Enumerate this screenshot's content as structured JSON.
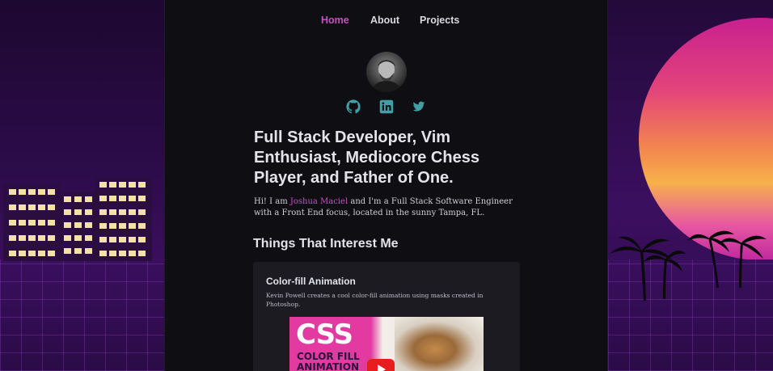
{
  "nav": {
    "items": [
      {
        "label": "Home",
        "active": true
      },
      {
        "label": "About",
        "active": false
      },
      {
        "label": "Projects",
        "active": false
      }
    ]
  },
  "profile": {
    "social_icons": [
      "github-icon",
      "linkedin-icon",
      "twitter-icon"
    ]
  },
  "hero": {
    "headline": "Full Stack Developer, Vim Enthusiast, Mediocore Chess Player, and Father of One.",
    "intro_prefix": "Hi! I am ",
    "intro_name": "Joshua Maciel",
    "intro_suffix": " and I'm a Full Stack Software Engineer with a Front End focus, located in the sunny Tampa, FL."
  },
  "interests": {
    "title": "Things That Interest Me",
    "cards": [
      {
        "title": "Color-fill Animation",
        "description": "Kevin Powell creates a cool color-fill animation using masks created in Photoshop.",
        "thumbnail_text": "CSS",
        "thumbnail_subtext": "COLOR FILL ANIMATION"
      }
    ]
  },
  "colors": {
    "accent": "#c94fc4",
    "social_icon": "#3fa0a6",
    "panel": "#0f0f13",
    "card": "#1b1b21"
  }
}
